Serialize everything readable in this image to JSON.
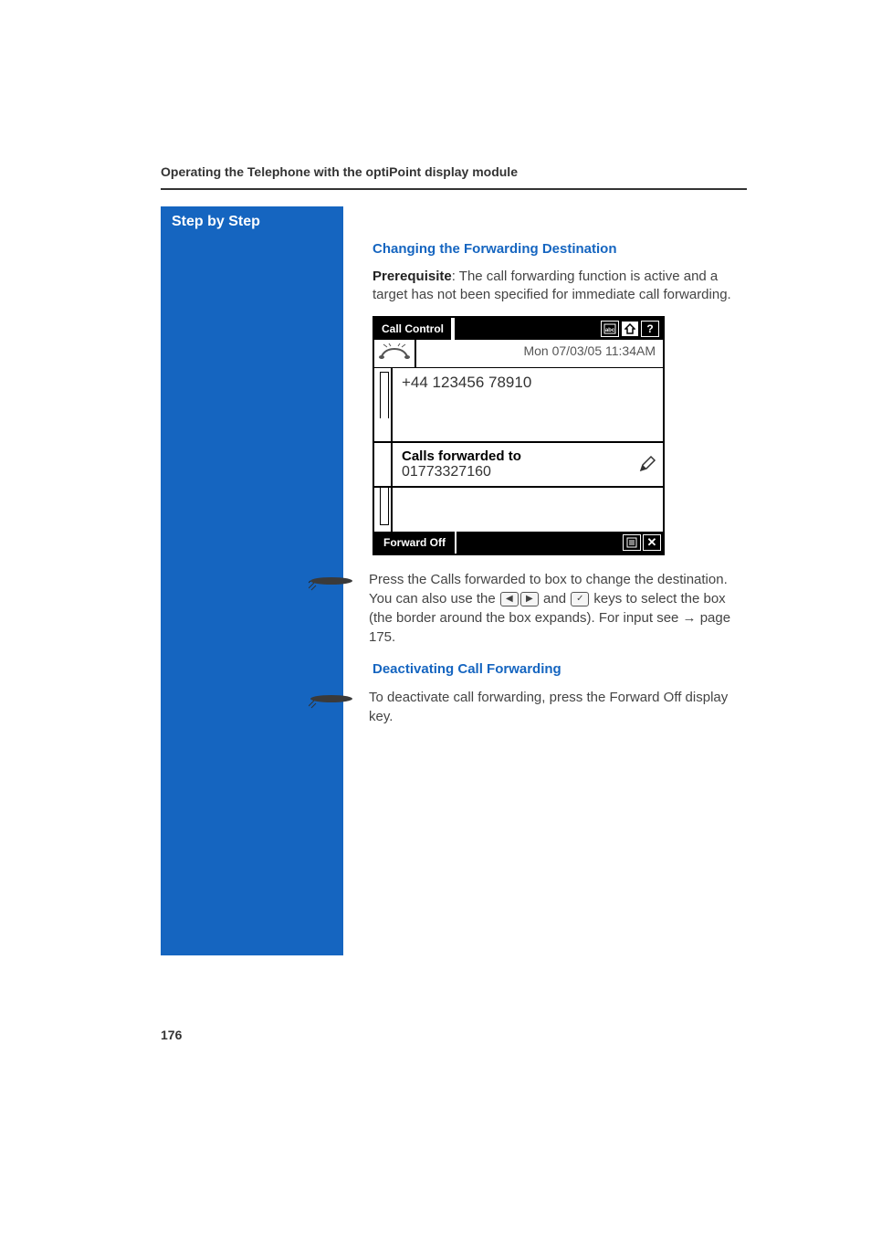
{
  "header": {
    "title": "Operating the Telephone with the optiPoint display module"
  },
  "sidebar": {
    "title": "Step by Step"
  },
  "section1": {
    "title": "Changing the Forwarding Destination",
    "prereq_label": "Prerequisite",
    "prereq_text": ": The call forwarding function is active and a target has not been specified for immediate call forwarding."
  },
  "phone": {
    "top_tab": "Call Control",
    "datetime": "Mon 07/03/05 11:34AM",
    "number": "+44 123456 78910",
    "forward_label": "Calls forwarded to",
    "forward_number": "01773327160",
    "bottom_btn": "Forward Off"
  },
  "instruction1": {
    "part1": "Press the ",
    "bold1": "Calls forwarded to",
    "part2": " box to change the destination. You can also use the ",
    "part3": " and ",
    "part4": " keys to select the box (the border around the box expands). For input see ",
    "arrow": "→",
    "pageref": " page 175."
  },
  "section2": {
    "title": "Deactivating Call Forwarding",
    "text1": "To deactivate call forwarding, press the ",
    "bold1": "Forward Off",
    "text2": " display key."
  },
  "pagenum": "176"
}
